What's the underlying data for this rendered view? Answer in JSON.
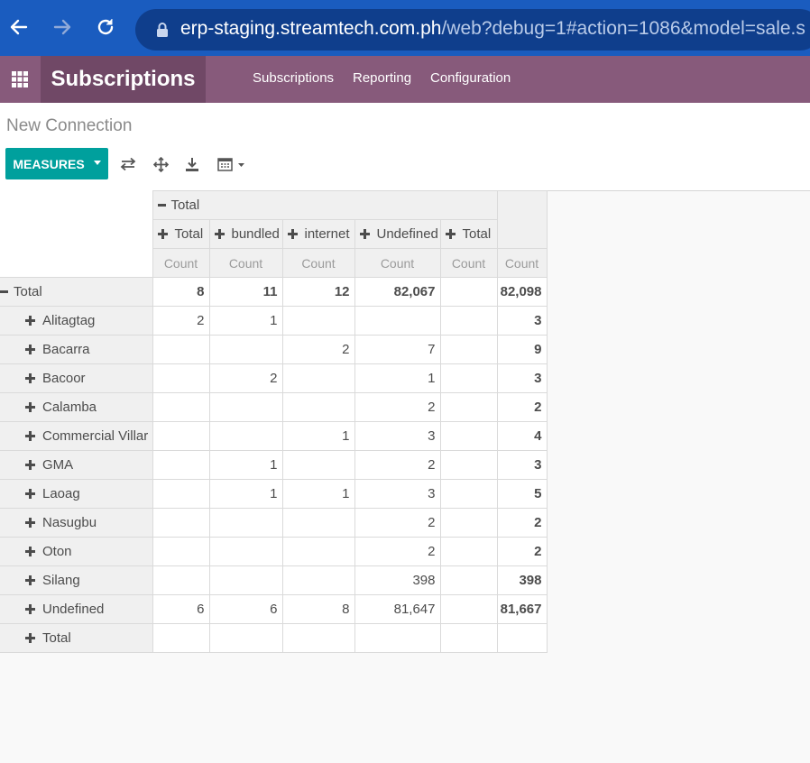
{
  "browser": {
    "url_host": "erp-staging.streamtech.com.ph",
    "url_path": "/web?debug=1#action=1086&model=sale.s"
  },
  "app": {
    "brand": "Subscriptions",
    "menu": [
      "Subscriptions",
      "Reporting",
      "Configuration"
    ]
  },
  "control_panel": {
    "breadcrumb": "New Connection",
    "measures_label": "MEASURES"
  },
  "pivot": {
    "top_header": "Total",
    "col_headers": [
      "Total",
      "bundled",
      "internet",
      "Undefined",
      "Total"
    ],
    "measure_label": "Count",
    "total_row": {
      "label": "Total",
      "values": [
        "8",
        "11",
        "12",
        "82,067",
        "",
        "82,098"
      ]
    },
    "rows": [
      {
        "label": "Alitagtag",
        "values": [
          "2",
          "1",
          "",
          "",
          "",
          "3"
        ]
      },
      {
        "label": "Bacarra",
        "values": [
          "",
          "",
          "2",
          "7",
          "",
          "9"
        ]
      },
      {
        "label": "Bacoor",
        "values": [
          "",
          "2",
          "",
          "1",
          "",
          "3"
        ]
      },
      {
        "label": "Calamba",
        "values": [
          "",
          "",
          "",
          "2",
          "",
          "2"
        ]
      },
      {
        "label": "Commercial Villar",
        "values": [
          "",
          "",
          "1",
          "3",
          "",
          "4"
        ]
      },
      {
        "label": "GMA",
        "values": [
          "",
          "1",
          "",
          "2",
          "",
          "3"
        ]
      },
      {
        "label": "Laoag",
        "values": [
          "",
          "1",
          "1",
          "3",
          "",
          "5"
        ]
      },
      {
        "label": "Nasugbu",
        "values": [
          "",
          "",
          "",
          "2",
          "",
          "2"
        ]
      },
      {
        "label": "Oton",
        "values": [
          "",
          "",
          "",
          "2",
          "",
          "2"
        ]
      },
      {
        "label": "Silang",
        "values": [
          "",
          "",
          "",
          "398",
          "",
          "398"
        ]
      },
      {
        "label": "Undefined",
        "values": [
          "6",
          "6",
          "8",
          "81,647",
          "",
          "81,667"
        ]
      },
      {
        "label": "Total",
        "values": [
          "",
          "",
          "",
          "",
          "",
          ""
        ]
      }
    ]
  }
}
